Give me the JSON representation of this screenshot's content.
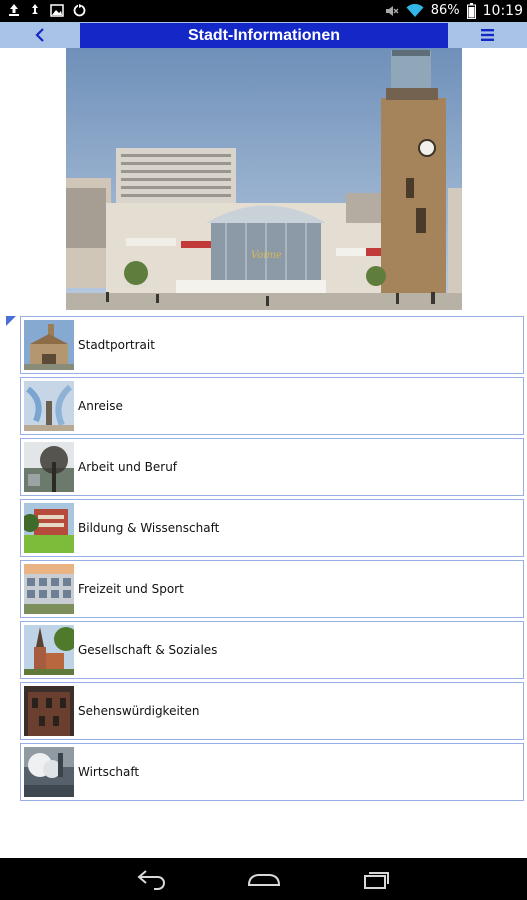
{
  "status_bar": {
    "battery_percent": "86%",
    "time": "10:19",
    "left_icons": [
      "upload-icon",
      "usb-icon",
      "image-icon",
      "sync-icon"
    ],
    "right_icons": [
      "mute-icon",
      "wifi-icon",
      "battery-icon"
    ]
  },
  "header": {
    "back_label": "<",
    "title": "Stadt-Informationen",
    "menu_label": "≡",
    "colors": {
      "bar": "#a9c3e6",
      "title_bg": "#1428c8",
      "accent": "#1a3ad4"
    }
  },
  "hero": {
    "icon": "city-square-photo"
  },
  "list": {
    "items": [
      {
        "label": "Stadtportrait",
        "thumb": "station-photo"
      },
      {
        "label": "Anreise",
        "thumb": "sculpture-photo"
      },
      {
        "label": "Arbeit und Beruf",
        "thumb": "tree-building-photo"
      },
      {
        "label": "Bildung & Wissenschaft",
        "thumb": "campus-photo"
      },
      {
        "label": "Freizeit und Sport",
        "thumb": "arena-photo"
      },
      {
        "label": "Gesellschaft & Soziales",
        "thumb": "church-photo"
      },
      {
        "label": "Sehenswürdigkeiten",
        "thumb": "castle-photo"
      },
      {
        "label": "Wirtschaft",
        "thumb": "industry-photo"
      }
    ]
  },
  "nav_bar": {
    "icons": [
      "back-nav-icon",
      "home-nav-icon",
      "recents-nav-icon"
    ]
  }
}
